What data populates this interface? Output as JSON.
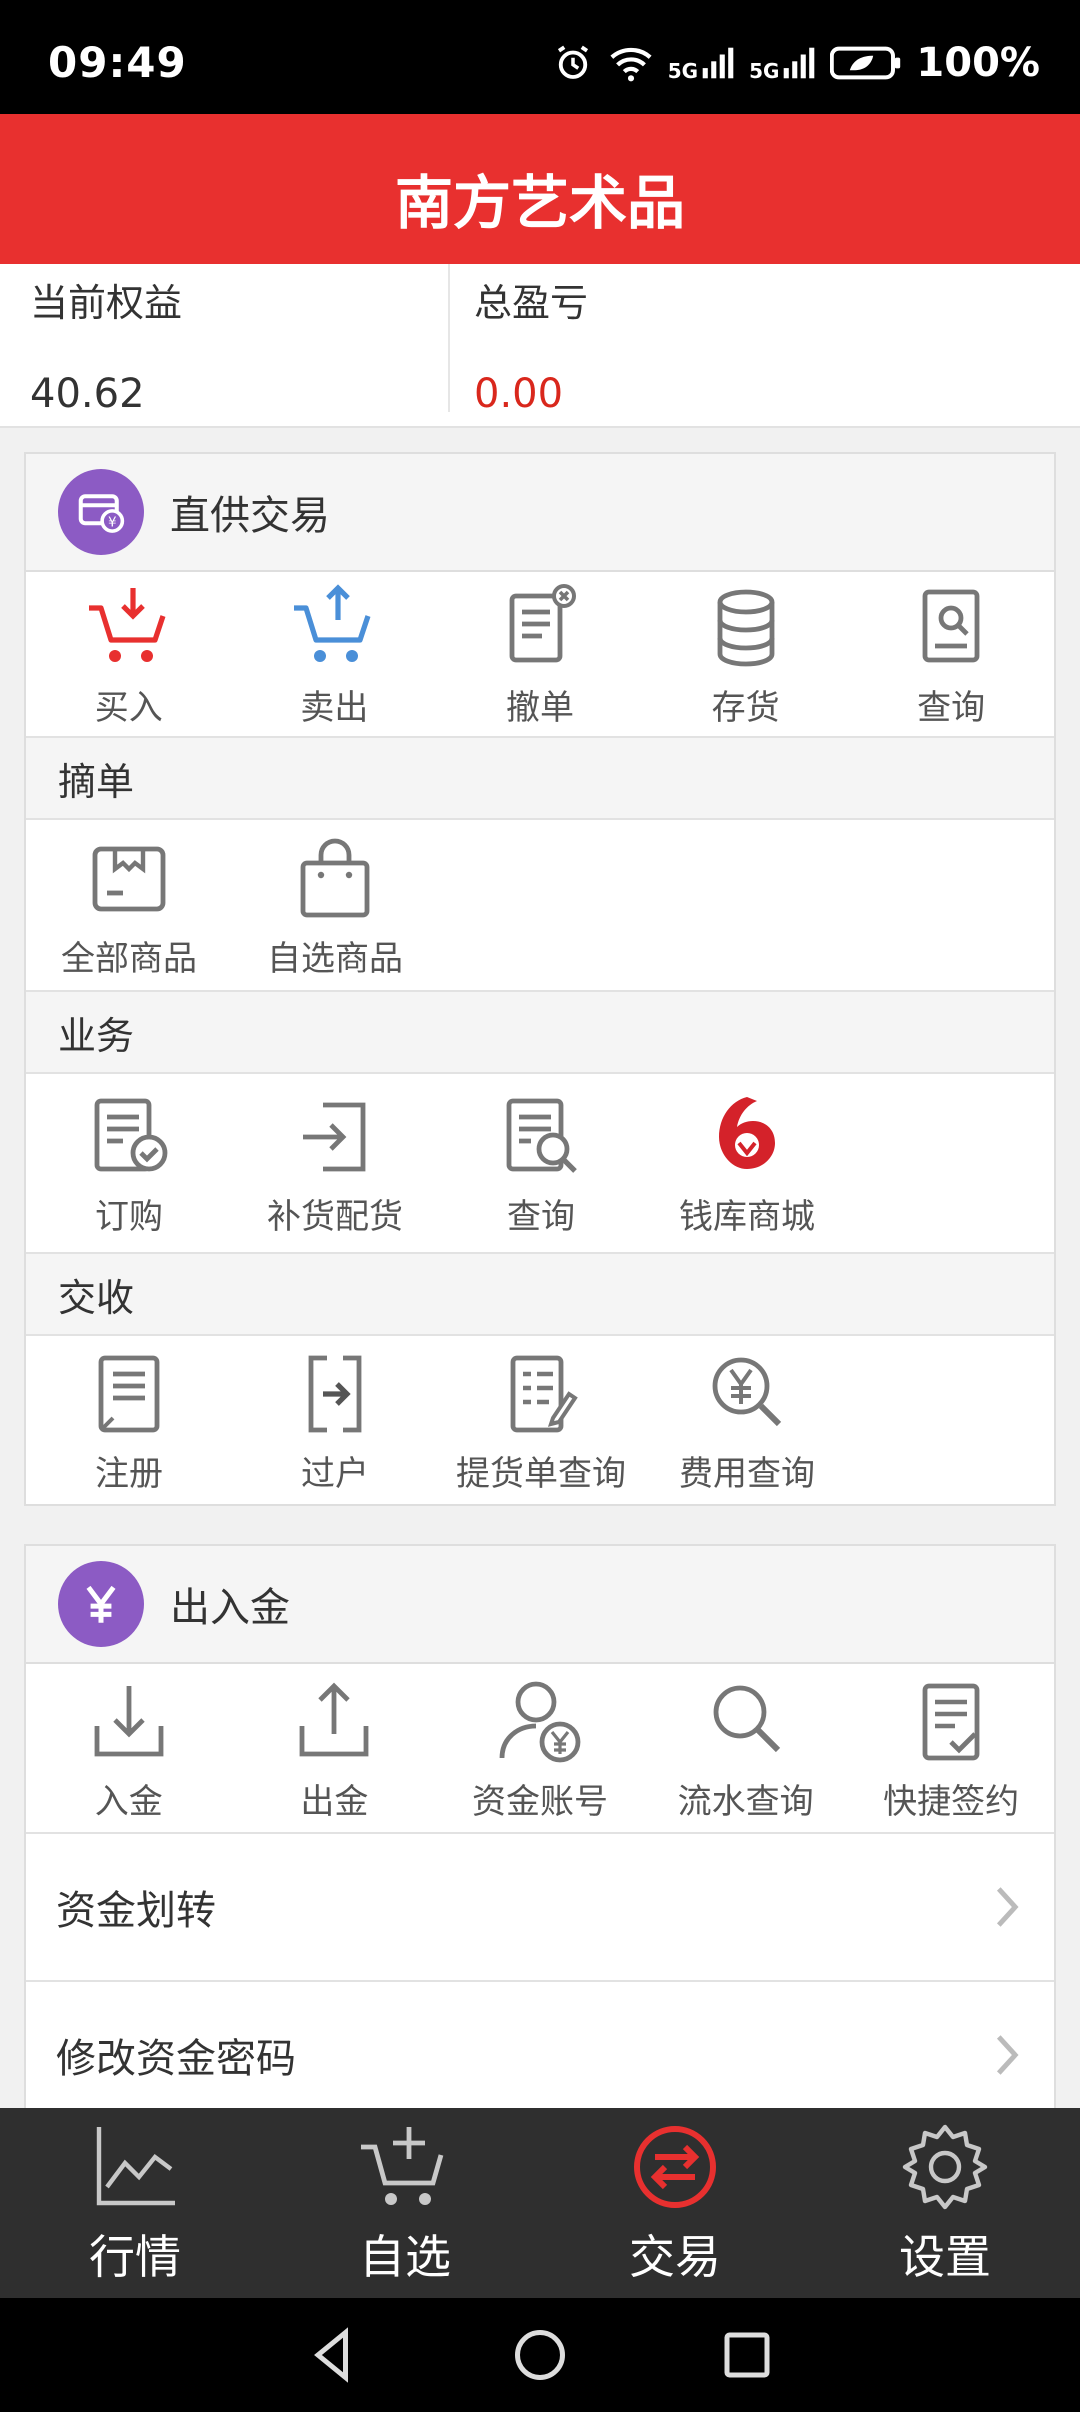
{
  "status": {
    "time": "09:49",
    "battery": "100%",
    "net1": "5G",
    "net2": "5G"
  },
  "app": {
    "title": "南方艺术品"
  },
  "summary": {
    "equity_label": "当前权益",
    "equity_value": "40.62",
    "pnl_label": "总盈亏",
    "pnl_value": "0.00"
  },
  "direct": {
    "title": "直供交易",
    "items": [
      {
        "label": "买入",
        "icon": "cart-down-icon"
      },
      {
        "label": "卖出",
        "icon": "cart-up-icon"
      },
      {
        "label": "撤单",
        "icon": "cancel-order-icon"
      },
      {
        "label": "存货",
        "icon": "database-icon"
      },
      {
        "label": "查询",
        "icon": "search-doc-icon"
      }
    ],
    "pick": {
      "title": "摘单",
      "items": [
        {
          "label": "全部商品",
          "icon": "box-icon"
        },
        {
          "label": "自选商品",
          "icon": "bag-icon"
        }
      ]
    },
    "business": {
      "title": "业务",
      "items": [
        {
          "label": "订购",
          "icon": "doc-check-icon"
        },
        {
          "label": "补货配货",
          "icon": "arrow-in-icon"
        },
        {
          "label": "查询",
          "icon": "doc-search-icon"
        },
        {
          "label": "钱库商城",
          "icon": "qianku-logo-icon"
        }
      ]
    },
    "delivery": {
      "title": "交收",
      "items": [
        {
          "label": "注册",
          "icon": "doc-lines-icon"
        },
        {
          "label": "过户",
          "icon": "transfer-icon"
        },
        {
          "label": "提货单查询",
          "icon": "doc-pen-icon"
        },
        {
          "label": "费用查询",
          "icon": "yen-search-icon"
        }
      ]
    }
  },
  "funds": {
    "title": "出入金",
    "items": [
      {
        "label": "入金",
        "icon": "download-tray-icon"
      },
      {
        "label": "出金",
        "icon": "upload-tray-icon"
      },
      {
        "label": "资金账号",
        "icon": "user-yen-icon"
      },
      {
        "label": "流水查询",
        "icon": "magnifier-icon"
      },
      {
        "label": "快捷签约",
        "icon": "doc-sign-icon"
      }
    ],
    "rows": [
      {
        "label": "资金划转"
      },
      {
        "label": "修改资金密码"
      }
    ]
  },
  "tabs": [
    {
      "label": "行情",
      "icon": "chart-line-icon"
    },
    {
      "label": "自选",
      "icon": "cart-add-icon"
    },
    {
      "label": "交易",
      "icon": "exchange-icon",
      "active": true
    },
    {
      "label": "设置",
      "icon": "gear-icon"
    }
  ],
  "colors": {
    "brand": "#e8302f",
    "purple": "#8c5bc4",
    "red_value": "#d9271c",
    "tab_bg": "#2f2f2f"
  }
}
